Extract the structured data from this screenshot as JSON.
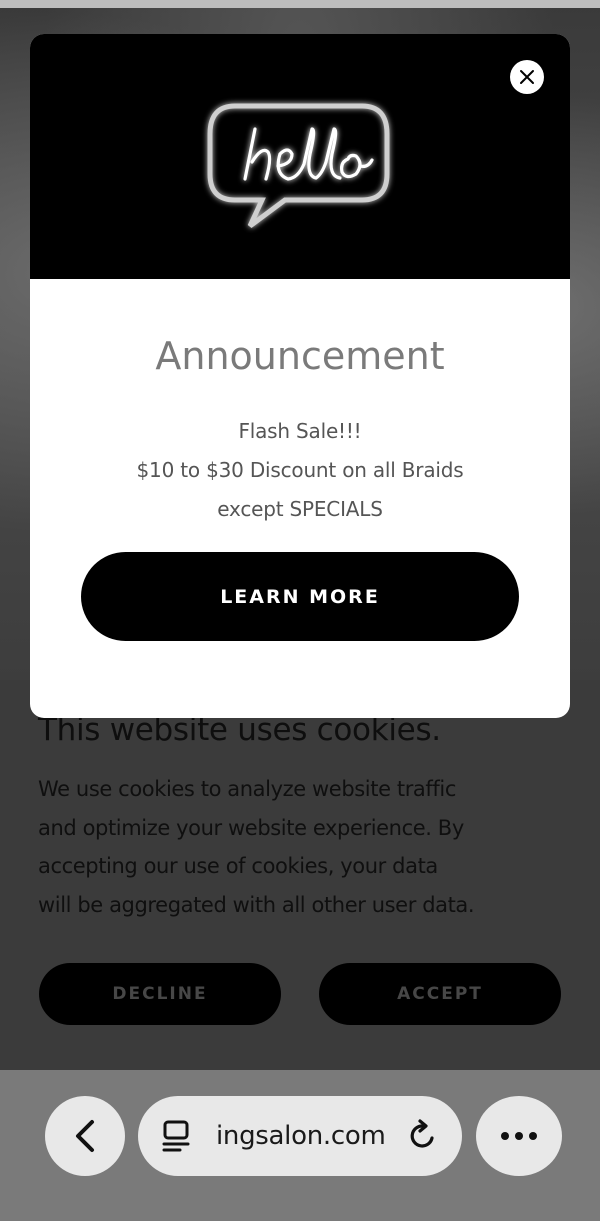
{
  "announcement": {
    "hero_image": "hello-neon-sign",
    "title": "Announcement",
    "lines": [
      "Flash Sale!!!",
      "$10 to $30 Discount on all Braids",
      "except SPECIALS"
    ],
    "cta_label": "LEARN MORE",
    "close_icon": "close-icon"
  },
  "cookie_banner": {
    "title": "This website uses cookies.",
    "lines": [
      "We use cookies to analyze website traffic",
      "and optimize your website experience. By",
      "accepting our use of cookies, your data",
      "will be aggregated with all other user data."
    ],
    "decline_label": "DECLINE",
    "accept_label": "ACCEPT"
  },
  "browser": {
    "url": "ingsalon.com",
    "back_icon": "chevron-left-icon",
    "tabs_icon": "tab-overview-icon",
    "reload_icon": "reload-icon",
    "more_icon": "more-dots-icon"
  }
}
